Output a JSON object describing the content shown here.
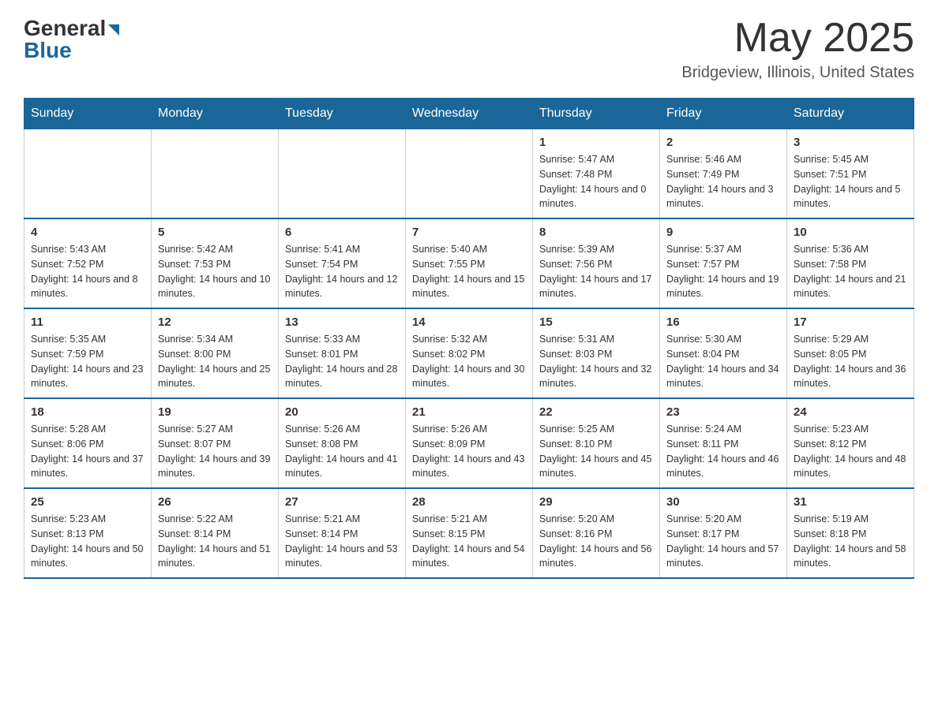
{
  "logo": {
    "general": "General",
    "blue": "Blue"
  },
  "title": {
    "month": "May 2025",
    "location": "Bridgeview, Illinois, United States"
  },
  "weekdays": [
    "Sunday",
    "Monday",
    "Tuesday",
    "Wednesday",
    "Thursday",
    "Friday",
    "Saturday"
  ],
  "weeks": [
    [
      {
        "day": "",
        "info": ""
      },
      {
        "day": "",
        "info": ""
      },
      {
        "day": "",
        "info": ""
      },
      {
        "day": "",
        "info": ""
      },
      {
        "day": "1",
        "info": "Sunrise: 5:47 AM\nSunset: 7:48 PM\nDaylight: 14 hours and 0 minutes."
      },
      {
        "day": "2",
        "info": "Sunrise: 5:46 AM\nSunset: 7:49 PM\nDaylight: 14 hours and 3 minutes."
      },
      {
        "day": "3",
        "info": "Sunrise: 5:45 AM\nSunset: 7:51 PM\nDaylight: 14 hours and 5 minutes."
      }
    ],
    [
      {
        "day": "4",
        "info": "Sunrise: 5:43 AM\nSunset: 7:52 PM\nDaylight: 14 hours and 8 minutes."
      },
      {
        "day": "5",
        "info": "Sunrise: 5:42 AM\nSunset: 7:53 PM\nDaylight: 14 hours and 10 minutes."
      },
      {
        "day": "6",
        "info": "Sunrise: 5:41 AM\nSunset: 7:54 PM\nDaylight: 14 hours and 12 minutes."
      },
      {
        "day": "7",
        "info": "Sunrise: 5:40 AM\nSunset: 7:55 PM\nDaylight: 14 hours and 15 minutes."
      },
      {
        "day": "8",
        "info": "Sunrise: 5:39 AM\nSunset: 7:56 PM\nDaylight: 14 hours and 17 minutes."
      },
      {
        "day": "9",
        "info": "Sunrise: 5:37 AM\nSunset: 7:57 PM\nDaylight: 14 hours and 19 minutes."
      },
      {
        "day": "10",
        "info": "Sunrise: 5:36 AM\nSunset: 7:58 PM\nDaylight: 14 hours and 21 minutes."
      }
    ],
    [
      {
        "day": "11",
        "info": "Sunrise: 5:35 AM\nSunset: 7:59 PM\nDaylight: 14 hours and 23 minutes."
      },
      {
        "day": "12",
        "info": "Sunrise: 5:34 AM\nSunset: 8:00 PM\nDaylight: 14 hours and 25 minutes."
      },
      {
        "day": "13",
        "info": "Sunrise: 5:33 AM\nSunset: 8:01 PM\nDaylight: 14 hours and 28 minutes."
      },
      {
        "day": "14",
        "info": "Sunrise: 5:32 AM\nSunset: 8:02 PM\nDaylight: 14 hours and 30 minutes."
      },
      {
        "day": "15",
        "info": "Sunrise: 5:31 AM\nSunset: 8:03 PM\nDaylight: 14 hours and 32 minutes."
      },
      {
        "day": "16",
        "info": "Sunrise: 5:30 AM\nSunset: 8:04 PM\nDaylight: 14 hours and 34 minutes."
      },
      {
        "day": "17",
        "info": "Sunrise: 5:29 AM\nSunset: 8:05 PM\nDaylight: 14 hours and 36 minutes."
      }
    ],
    [
      {
        "day": "18",
        "info": "Sunrise: 5:28 AM\nSunset: 8:06 PM\nDaylight: 14 hours and 37 minutes."
      },
      {
        "day": "19",
        "info": "Sunrise: 5:27 AM\nSunset: 8:07 PM\nDaylight: 14 hours and 39 minutes."
      },
      {
        "day": "20",
        "info": "Sunrise: 5:26 AM\nSunset: 8:08 PM\nDaylight: 14 hours and 41 minutes."
      },
      {
        "day": "21",
        "info": "Sunrise: 5:26 AM\nSunset: 8:09 PM\nDaylight: 14 hours and 43 minutes."
      },
      {
        "day": "22",
        "info": "Sunrise: 5:25 AM\nSunset: 8:10 PM\nDaylight: 14 hours and 45 minutes."
      },
      {
        "day": "23",
        "info": "Sunrise: 5:24 AM\nSunset: 8:11 PM\nDaylight: 14 hours and 46 minutes."
      },
      {
        "day": "24",
        "info": "Sunrise: 5:23 AM\nSunset: 8:12 PM\nDaylight: 14 hours and 48 minutes."
      }
    ],
    [
      {
        "day": "25",
        "info": "Sunrise: 5:23 AM\nSunset: 8:13 PM\nDaylight: 14 hours and 50 minutes."
      },
      {
        "day": "26",
        "info": "Sunrise: 5:22 AM\nSunset: 8:14 PM\nDaylight: 14 hours and 51 minutes."
      },
      {
        "day": "27",
        "info": "Sunrise: 5:21 AM\nSunset: 8:14 PM\nDaylight: 14 hours and 53 minutes."
      },
      {
        "day": "28",
        "info": "Sunrise: 5:21 AM\nSunset: 8:15 PM\nDaylight: 14 hours and 54 minutes."
      },
      {
        "day": "29",
        "info": "Sunrise: 5:20 AM\nSunset: 8:16 PM\nDaylight: 14 hours and 56 minutes."
      },
      {
        "day": "30",
        "info": "Sunrise: 5:20 AM\nSunset: 8:17 PM\nDaylight: 14 hours and 57 minutes."
      },
      {
        "day": "31",
        "info": "Sunrise: 5:19 AM\nSunset: 8:18 PM\nDaylight: 14 hours and 58 minutes."
      }
    ]
  ]
}
